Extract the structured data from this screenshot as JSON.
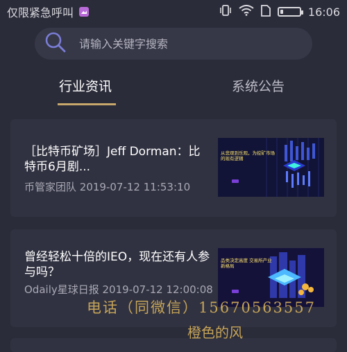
{
  "status_bar": {
    "carrier": "仅限紧急呼叫",
    "time": "16:06",
    "battery_level": 0.15
  },
  "search": {
    "placeholder": "请输入关键字搜索"
  },
  "tabs": [
    {
      "label": "行业资讯",
      "active": true
    },
    {
      "label": "系统公告",
      "active": false
    }
  ],
  "articles": [
    {
      "title": "［比特币矿场］Jeff Dorman：比特币6月剧...",
      "source": "币管家团队",
      "date": "2019-07-12 11:53:10",
      "thumb_title": "从悲观到乐观，为挖矿市场的现有逻辑",
      "thumb_btn": "GO"
    },
    {
      "title": "曾经轻松十倍的IEO，现在还有人参与吗？",
      "source": "Odaily星球日报",
      "date": "2019-07-12 12:00:08",
      "thumb_title": "品类决定高度  交易所产业新格局",
      "thumb_btn": "GO"
    }
  ],
  "watermark": {
    "line1": "电话（同微信）15670563557",
    "line2": "橙色的风"
  },
  "colors": {
    "background": "#2b2c3a",
    "card": "#313241",
    "accent": "#c9a96b",
    "watermark": "#d7b25c"
  }
}
